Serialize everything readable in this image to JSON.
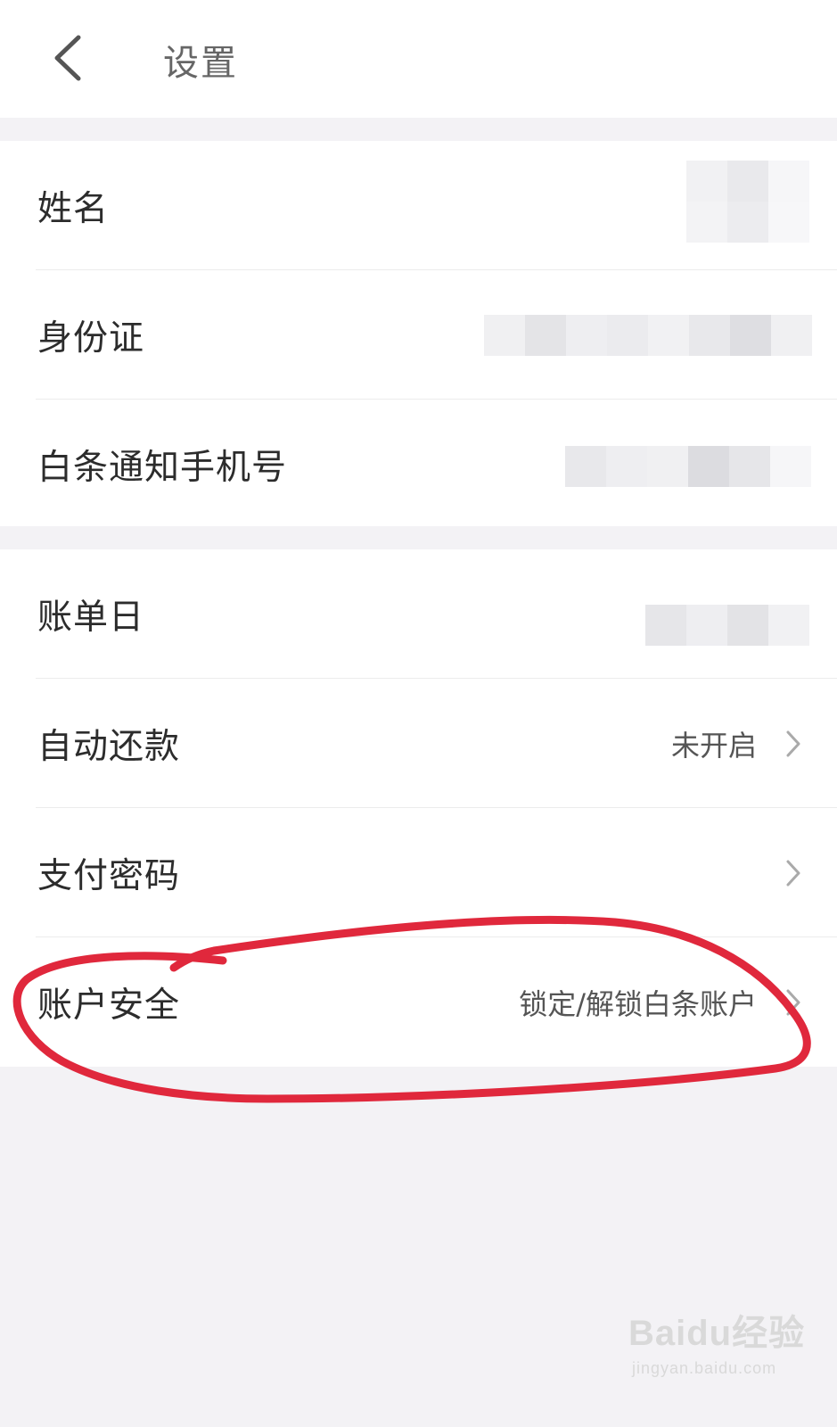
{
  "header": {
    "back_icon": "chevron-left-icon",
    "title": "设置"
  },
  "personal_info": [
    {
      "label": "姓名"
    },
    {
      "label": "身份证"
    },
    {
      "label": "白条通知手机号"
    }
  ],
  "account_settings": [
    {
      "label": "账单日"
    },
    {
      "label": "自动还款",
      "value": "未开启",
      "icon": "chevron-right-icon"
    },
    {
      "label": "支付密码",
      "icon": "chevron-right-icon"
    },
    {
      "label": "账户安全",
      "value": "锁定/解锁白条账户",
      "icon": "chevron-right-icon"
    }
  ],
  "watermark": {
    "brand": "Baidu经验",
    "url": "jingyan.baidu.com"
  },
  "colors": {
    "background": "#f3f2f5",
    "annotation": "#e0283c"
  }
}
